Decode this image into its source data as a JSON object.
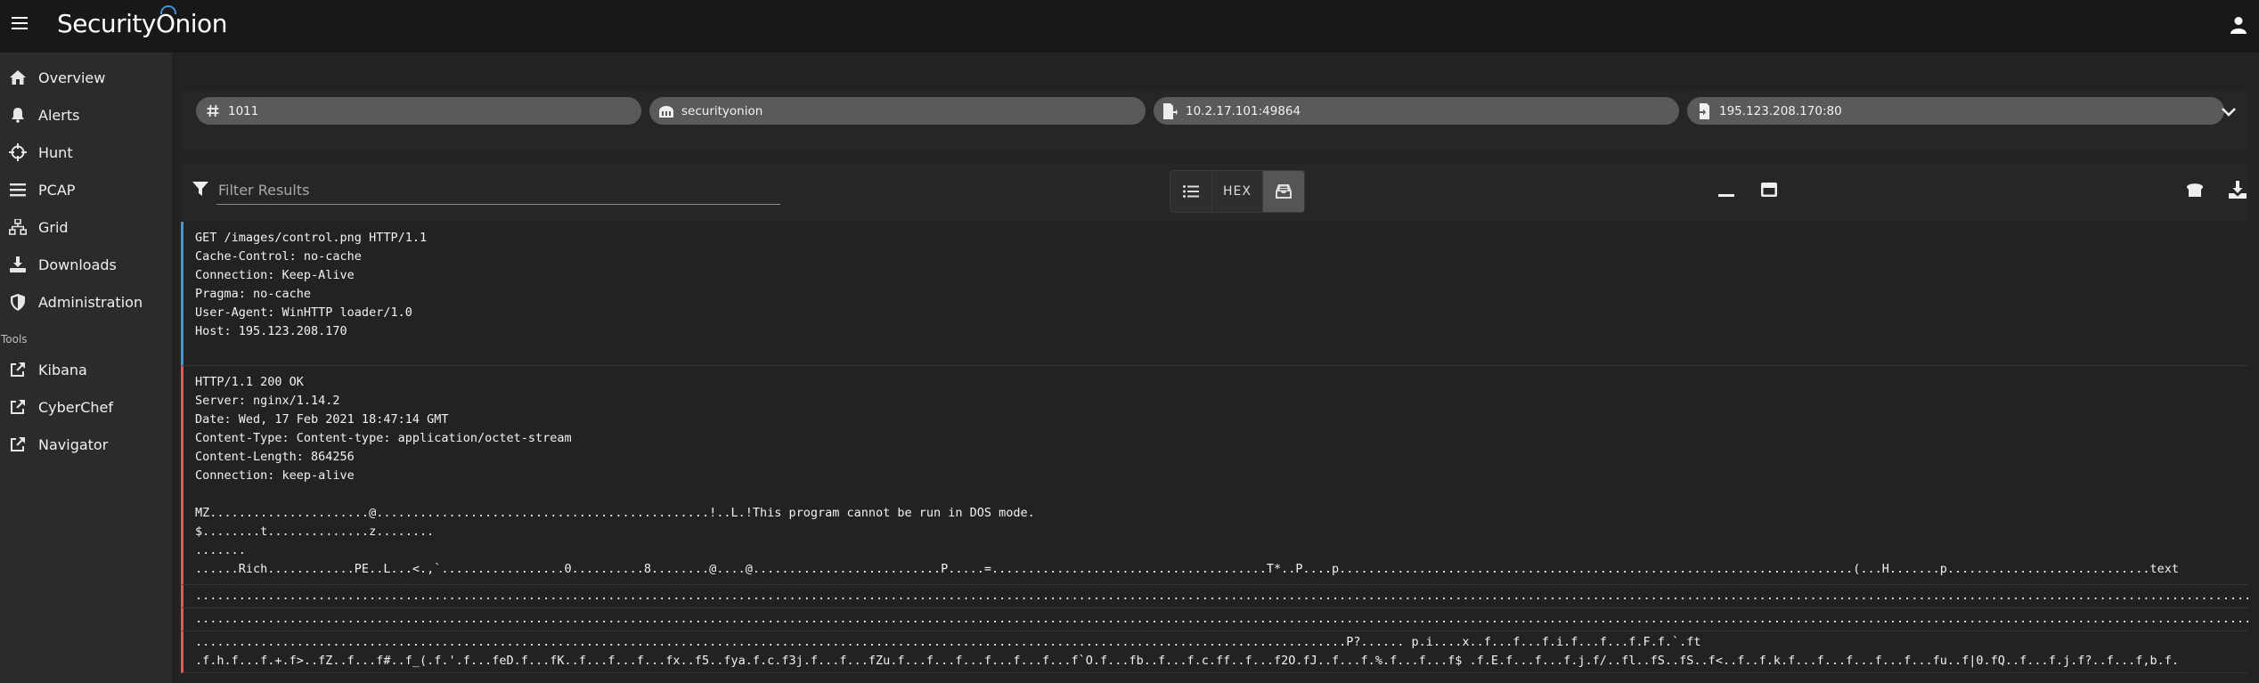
{
  "app": {
    "logo_text_pre": "Security",
    "logo_text_o": "O",
    "logo_text_post": "nion"
  },
  "sidebar": {
    "items": [
      {
        "label": "Overview",
        "icon": "home-icon"
      },
      {
        "label": "Alerts",
        "icon": "bell-icon"
      },
      {
        "label": "Hunt",
        "icon": "crosshairs-icon"
      },
      {
        "label": "PCAP",
        "icon": "list-icon"
      },
      {
        "label": "Grid",
        "icon": "sitemap-icon"
      },
      {
        "label": "Downloads",
        "icon": "download-icon"
      },
      {
        "label": "Administration",
        "icon": "shield-icon"
      }
    ],
    "tools_label": "Tools",
    "tools": [
      {
        "label": "Kibana",
        "icon": "external-link-icon"
      },
      {
        "label": "CyberChef",
        "icon": "external-link-icon"
      },
      {
        "label": "Navigator",
        "icon": "external-link-icon"
      }
    ]
  },
  "chips": {
    "id": "1011",
    "sensor": "securityonion",
    "source": "10.2.17.101:49864",
    "destination": "195.123.208.170:80"
  },
  "toolbar": {
    "filter_placeholder": "Filter Results",
    "hex_label": "HEX"
  },
  "request": {
    "lines": [
      "GET /images/control.png HTTP/1.1",
      "Cache-Control: no-cache",
      "Connection: Keep-Alive",
      "Pragma: no-cache",
      "User-Agent: WinHTTP loader/1.0",
      "Host: 195.123.208.170"
    ]
  },
  "response": {
    "headers": [
      "HTTP/1.1 200 OK",
      "Server: nginx/1.14.2",
      "Date: Wed, 17 Feb 2021 18:47:14 GMT",
      "Content-Type: Content-type: application/octet-stream",
      "Content-Length: 864256",
      "Connection: keep-alive"
    ],
    "body": [
      "MZ......................@..............................................!..L.!This program cannot be run in DOS mode.",
      "$........t..............z........",
      ".......",
      "......Rich............PE..L...<.,`.................0..........8........@....@..........................P.....=......................................T*..P....p.......................................................................(...H.......p............................text"
    ],
    "dots_1": "...................................................................................................................................................................................................................................................................................................",
    "dots_2": "...................................................................................................................................................................................................................................................................................................",
    "tail_1": "...............................................................................................................................................................P?...... p.i....x..f...f...f.i.f...f...f.F.f.`.ft",
    "tail_2": ".f.h.f...f.+.f>..fZ..f...f#..f_(.f.'.f...feD.f...fK..f...f...f...fx..f5..fya.f.c.f3j.f...f...fZu.f...f...f...f...f...f...f`O.f...fb..f...f.c.ff..f...f2O.fJ..f...f.%.f...f...f$ .f.E.f...f...f.j.f/..fl..fS..fS..f<..f..f.k.f...f...f...f...f...fu..f|0.fQ..f...f.j.f?..f...f,b.f."
  }
}
